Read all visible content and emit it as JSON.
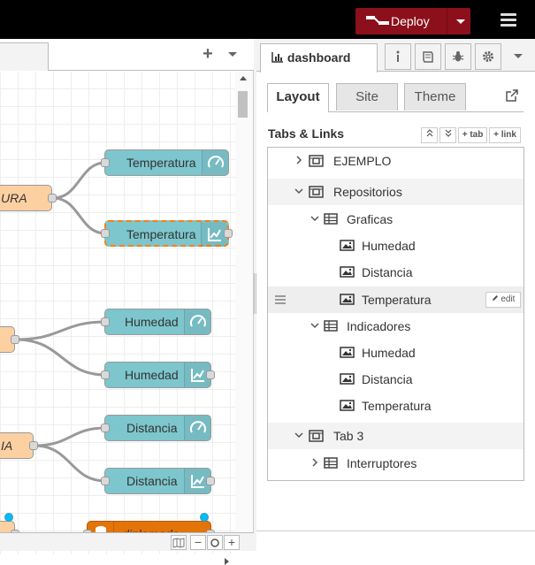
{
  "header": {
    "deploy_label": "Deploy",
    "deploy_color": "#8c101c"
  },
  "workspace": {
    "nodes": {
      "temp_gauge": "Temperatura",
      "temp_chart": "Temperatura",
      "hum_gauge": "Humedad",
      "hum_chart": "Humedad",
      "dist_gauge": "Distancia",
      "dist_chart": "Distancia",
      "db_node": "diplomado",
      "fn_1": "URA",
      "fn_3": "IA"
    },
    "colors": {
      "dashboard_node": "#7dc6cd",
      "function_node": "#fdd0a2",
      "db_node": "#e2740a",
      "selection": "#ff7f0e"
    }
  },
  "sidebar": {
    "tab_label": "dashboard",
    "sub_tabs": [
      "Layout",
      "Site",
      "Theme"
    ],
    "tabs_links_title": "Tabs & Links",
    "buttons": {
      "add_tab": "tab",
      "add_link": "link"
    },
    "edit_label": "edit",
    "tree": [
      {
        "label": "EJEMPLO"
      },
      {
        "label": "Repositorios"
      },
      {
        "label": "Graficas"
      },
      {
        "label": "Humedad"
      },
      {
        "label": "Distancia"
      },
      {
        "label": "Temperatura"
      },
      {
        "label": "Indicadores"
      },
      {
        "label": "Humedad"
      },
      {
        "label": "Distancia"
      },
      {
        "label": "Temperatura"
      },
      {
        "label": "Tab 3"
      },
      {
        "label": "Interruptores"
      }
    ]
  }
}
